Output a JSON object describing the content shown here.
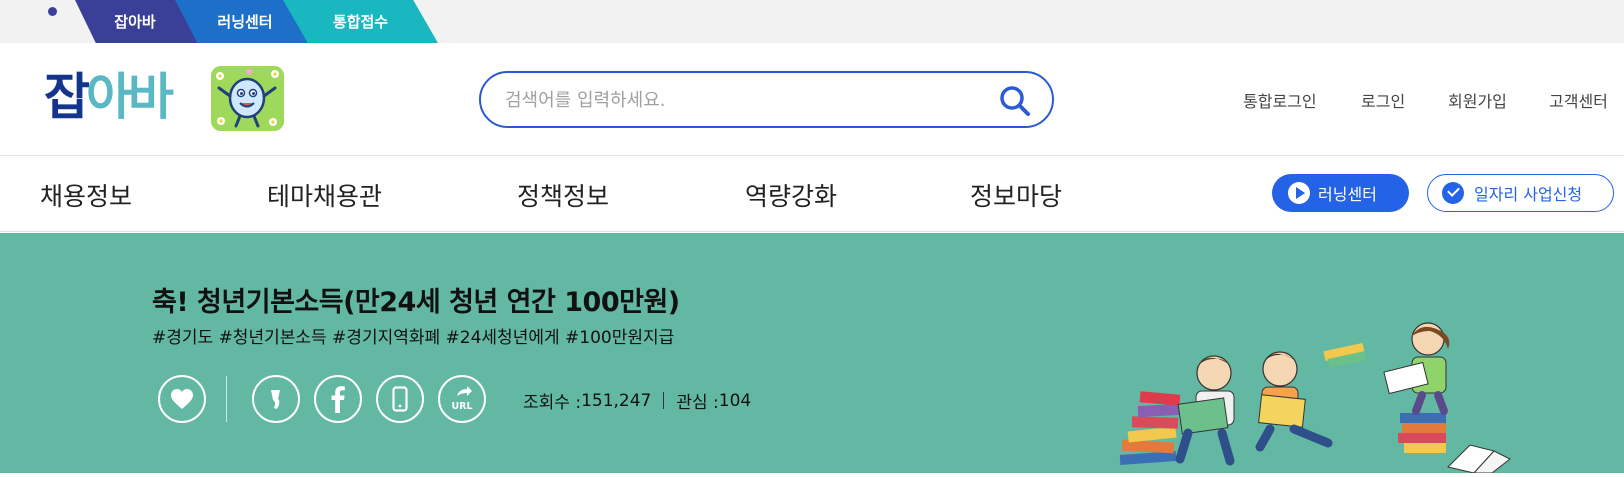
{
  "top_tabs": [
    "잡아바",
    "러닝센터",
    "통합접수"
  ],
  "logo": {
    "part1": "잡",
    "part2": "아바"
  },
  "search": {
    "placeholder": "검색어를 입력하세요."
  },
  "util_links": [
    "통합로그인",
    "로그인",
    "회원가입",
    "고객센터"
  ],
  "gnb": {
    "menu": [
      "채용정보",
      "테마채용관",
      "정책정보",
      "역량강화",
      "정보마당"
    ],
    "learning_center": "러닝센터",
    "job_apply": "일자리 사업신청"
  },
  "banner": {
    "title": "축! 청년기본소득(만24세 청년 연간 100만원)",
    "tags": "#경기도 #청년기본소득 #경기지역화폐 #24세청년에게 #100만원지급",
    "views_label": "조회수 : ",
    "views": "151,247",
    "interest_label": "관심 : ",
    "interest": "104",
    "url_label": "URL",
    "bg_color": "#63b8a3"
  },
  "colors": {
    "brand_navy": "#13358b",
    "brand_teal": "#59b8c4",
    "accent_blue": "#2463e6"
  }
}
